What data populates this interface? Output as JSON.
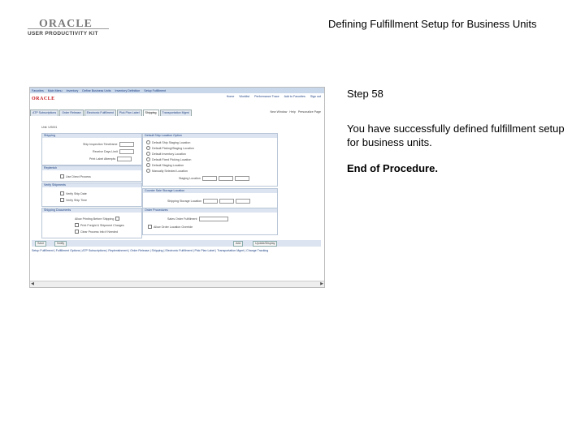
{
  "header": {
    "title": "Defining Fulfillment Setup for Business Units",
    "logo_word": "ORACLE",
    "logo_tag": "USER PRODUCTIVITY KIT"
  },
  "screenshot": {
    "menu_items": [
      "Favorites",
      "Main Menu",
      "Inventory",
      "Define Business Units",
      "Inventory Definition",
      "Setup Fulfillment"
    ],
    "brand": "ORACLE",
    "nav_links": [
      "Home",
      "Worklist",
      "Performance Trace",
      "Add to Favorites",
      "Sign out"
    ],
    "tabs": [
      "ATP Subscriptions",
      "Order Release",
      "Electronic Fulfillment",
      "Pick Plan Label",
      "Shipping",
      "Transportation Mgmt"
    ],
    "active_tab_index": 4,
    "topright": [
      "New Window",
      "Help",
      "Personalize Page"
    ],
    "unit_label": "Unit: US001",
    "panels": {
      "shipping": {
        "title": "Shipping",
        "rows": [
          "Ship Inspection Timeframe",
          "Receive Days Limit",
          "Print Label Attempts"
        ]
      },
      "replenish": {
        "title": "Replenish",
        "rows": [
          "Use Direct Process"
        ]
      },
      "verify": {
        "title": "Verify Shipments",
        "rows": [
          "Verify Ship Date",
          "Verify Ship Time"
        ]
      },
      "documents": {
        "title": "Shipping Documents",
        "rows": [
          "Allow Printing Before Shipping",
          "Print Freight & Shipment Charges",
          "Clear Process Info if Needed"
        ]
      },
      "default_loc": {
        "title": "Default Ship Location Option",
        "rows": [
          "Default Ship Staging Location",
          "Default Picking/Staging Location",
          "Default Inventory Location",
          "Default Fixed Picking Location",
          "Default Staging Location",
          "Manually Selected Location",
          "Staging Location"
        ]
      },
      "counter": {
        "title": "Counter Sale Storage Location",
        "rows": [
          "Shipping Storage Location"
        ]
      },
      "order": {
        "title": "Order Procedures",
        "rows": [
          "Sales Order Fulfillment",
          "Allow Order Location Override"
        ]
      }
    },
    "buttons": [
      "Save",
      "Notify",
      "Add",
      "Update/Display"
    ],
    "footer": "Setup Fulfillment | Fulfillment Options | ATP Subscriptions | Replenishment | Order Release | Shipping | Electronic Fulfillment | Pick Plan Label | Transportation Mgmt | Change Tracking"
  },
  "right_panel": {
    "step": "Step 58",
    "message": "You have successfully defined fulfillment setup for business units.",
    "end": "End of Procedure."
  }
}
